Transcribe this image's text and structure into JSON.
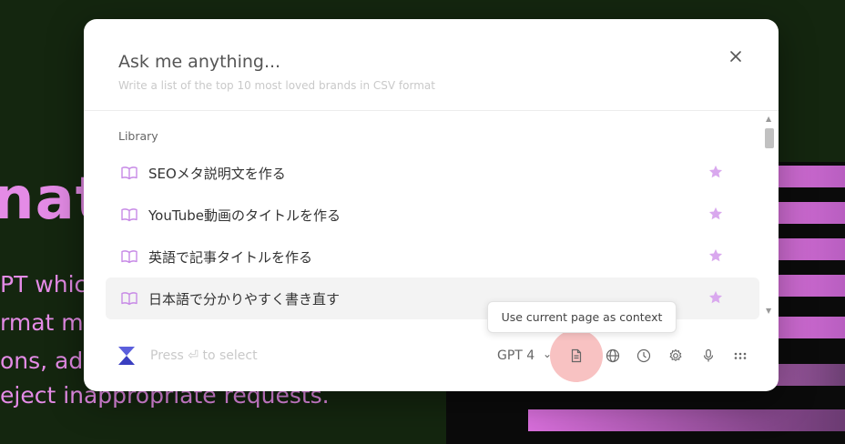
{
  "background": {
    "big_text": "nat",
    "line1": "PT whic",
    "line2": "rmat m",
    "line3": "ons, ad",
    "line4": "eject inappropriate requests."
  },
  "popup": {
    "title": "Ask me anything...",
    "hint": "Write a list of the top 10 most loved brands in CSV format",
    "close_icon": "close-icon",
    "section_label": "Library",
    "items": [
      {
        "label": "SEOメタ説明文を作る",
        "icon": "book-icon",
        "starred": true
      },
      {
        "label": "YouTube動画のタイトルを作る",
        "icon": "book-icon",
        "starred": true
      },
      {
        "label": "英語で記事タイトルを作る",
        "icon": "book-icon",
        "starred": true
      },
      {
        "label": "日本語で分かりやすく書き直す",
        "icon": "book-icon",
        "starred": true
      }
    ]
  },
  "footer": {
    "hint": "Press ⏎ to select",
    "model": "GPT 4",
    "tools": [
      "document-icon",
      "globe-icon",
      "clock-icon",
      "gear-icon",
      "microphone-icon",
      "grid-icon"
    ]
  },
  "tooltip": {
    "text": "Use current page as context"
  },
  "colors": {
    "accent": "#c78ae6",
    "star": "#d9a8ee",
    "background": "#14260f",
    "highlight": "#f7b7b7"
  }
}
